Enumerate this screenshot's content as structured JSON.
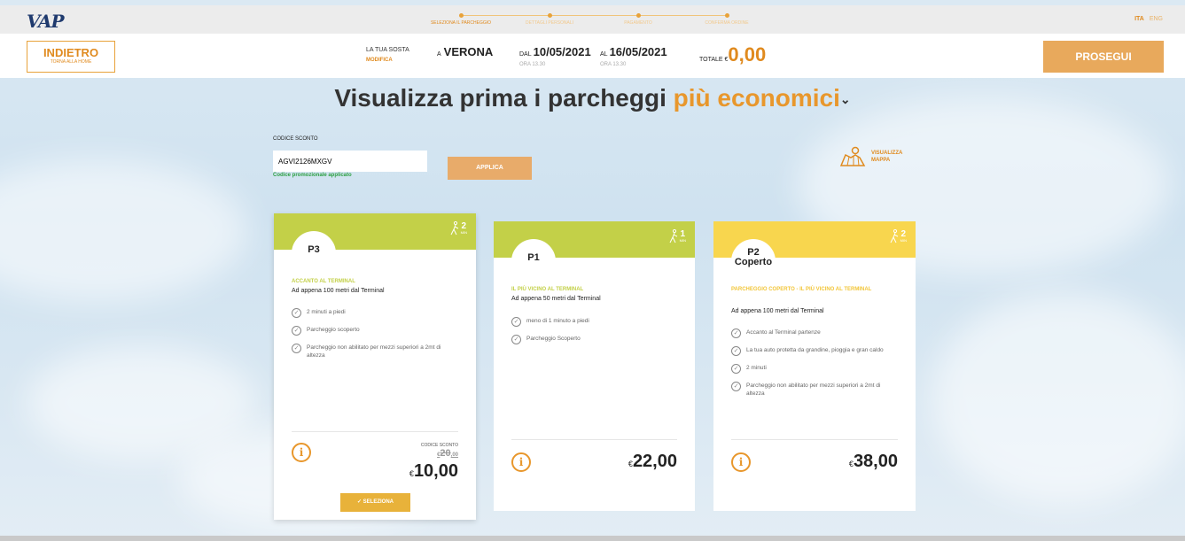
{
  "topbar": {
    "logo": "VAP",
    "steps": [
      {
        "label": "SELEZIONA IL PARCHEGGIO",
        "active": true
      },
      {
        "label": "DETTAGLI PERSONALI",
        "active": false
      },
      {
        "label": "PAGAMENTO",
        "active": false
      },
      {
        "label": "CONFERMA ORDINE",
        "active": false
      }
    ],
    "lang_active": "ITA",
    "lang_other": "ENG"
  },
  "header": {
    "back_label": "INDIETRO",
    "back_sub": "TORNA ALLA HOME",
    "sosta_label": "LA TUA SOSTA",
    "modifica": "MODIFICA",
    "city_prefix": "A",
    "city": "VERONA",
    "dal_prefix": "DAL",
    "dal_date": "10/05/2021",
    "dal_ora": "ORA 13.30",
    "al_prefix": "AL",
    "al_date": "16/05/2021",
    "al_ora": "ORA 13.30",
    "totale_label": "TOTALE €",
    "totale_value": "0,00",
    "prosegui": "PROSEGUI"
  },
  "title": {
    "main": "Visualizza prima i parcheggi ",
    "highlight": "più economici",
    "chevron": "⌄"
  },
  "discount": {
    "label": "CODICE SCONTO",
    "value": "AGVI2126MXGV",
    "status": "Codice promozionale applicato",
    "apply": "APPLICA",
    "map_line1": "VISUALIZZA",
    "map_line2": "MAPPA"
  },
  "colors": {
    "accent": "#e8972c",
    "green_band": "#c3d048",
    "yellow_band": "#f8d64e",
    "success": "#2ea043"
  },
  "cards": [
    {
      "name": "P3",
      "walk_n": "2",
      "walk_u": "MIN",
      "subtitle": "ACCANTO AL TERMINAL",
      "desc": "Ad appena 100 metri dal Terminal",
      "features": [
        "2 minuti a piedi",
        "Parcheggio scoperto",
        "Parcheggio non abilitato per mezzi superiori a 2mt di altezza"
      ],
      "codice_label": "CODICE SCONTO",
      "old_currency": "€",
      "old_price": "20",
      "old_cents": ",00",
      "currency": "€",
      "price": "10,00",
      "select": "SELEZIONA"
    },
    {
      "name": "P1",
      "walk_n": "1",
      "walk_u": "MIN",
      "subtitle": "IL PIÙ VICINO AL TERMINAL",
      "desc": "Ad appena 50 metri dal Terminal",
      "features": [
        "meno di 1 minuto a piedi",
        "Parcheggio Scoperto"
      ],
      "currency": "€",
      "price": "22,00"
    },
    {
      "name_line1": "P2",
      "name_line2": "Coperto",
      "walk_n": "2",
      "walk_u": "MIN",
      "subtitle": "PARCHEGGIO COPERTO - IL PIÙ VICINO AL TERMINAL",
      "desc": "Ad appena 100 metri dal Terminal",
      "features": [
        "Accanto al Terminal partenze",
        "La tua auto protetta da grandine, pioggia e gran caldo",
        "2 minuti",
        "Parcheggio non abilitato per mezzi superiori a 2mt di altezza"
      ],
      "currency": "€",
      "price": "38,00"
    }
  ]
}
